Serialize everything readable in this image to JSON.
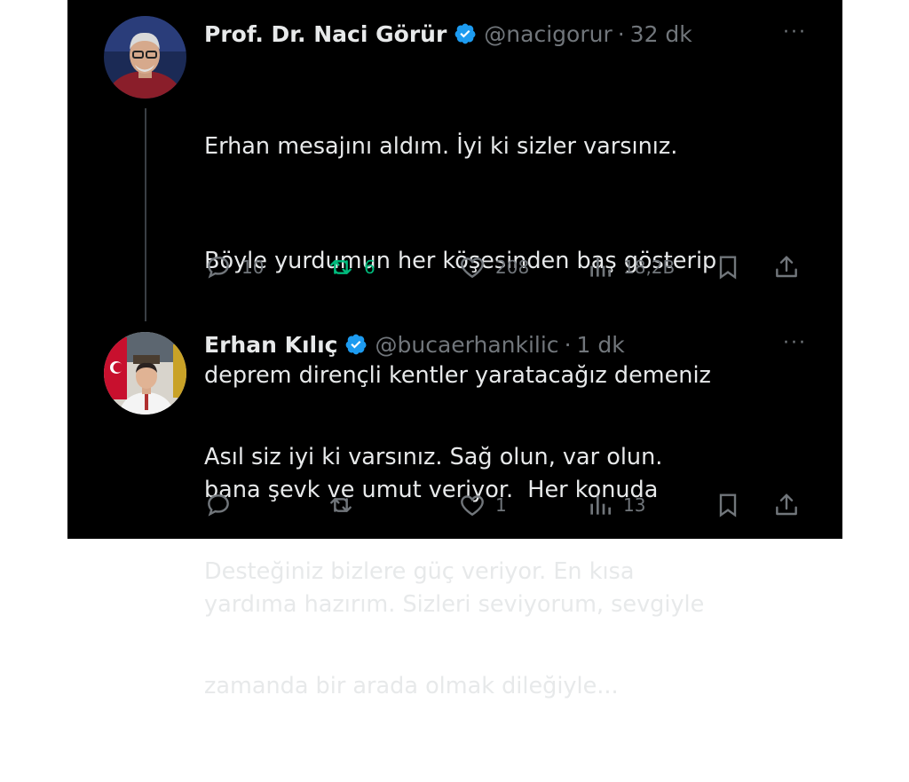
{
  "tweets": [
    {
      "name": "Prof. Dr. Naci Görür",
      "handle": "@nacigorur",
      "dot": "·",
      "time": "32 dk",
      "more": "···",
      "lines": [
        "Erhan mesajını aldım. İyi ki sizler varsınız.",
        "Böyle yurdumun her köşesinden baş gösterip",
        "deprem dirençli kentler yaratacağız demeniz",
        "bana şevk ve umut veriyor.  Her konuda",
        "yardıma hazırım. Sizleri seviyorum, sevgiyle"
      ],
      "stats": {
        "replies": "10",
        "retweets": "6",
        "likes": "208",
        "views": "18,2B"
      }
    },
    {
      "name": "Erhan Kılıç",
      "handle": "@bucaerhankilic",
      "dot": "·",
      "time": "1 dk",
      "more": "···",
      "lines": [
        "Asıl siz iyi ki varsınız. Sağ olun, var olun.",
        "Desteğiniz bizlere güç veriyor. En kısa",
        "zamanda bir arada olmak dileğiyle..."
      ],
      "stats": {
        "replies": "",
        "retweets": "",
        "likes": "1",
        "views": "13"
      }
    }
  ],
  "colors": {
    "background": "#000000",
    "text": "#e7e9ea",
    "muted": "#71767b",
    "verified": "#1d9bf0",
    "retweet_active": "#00ba7c"
  }
}
